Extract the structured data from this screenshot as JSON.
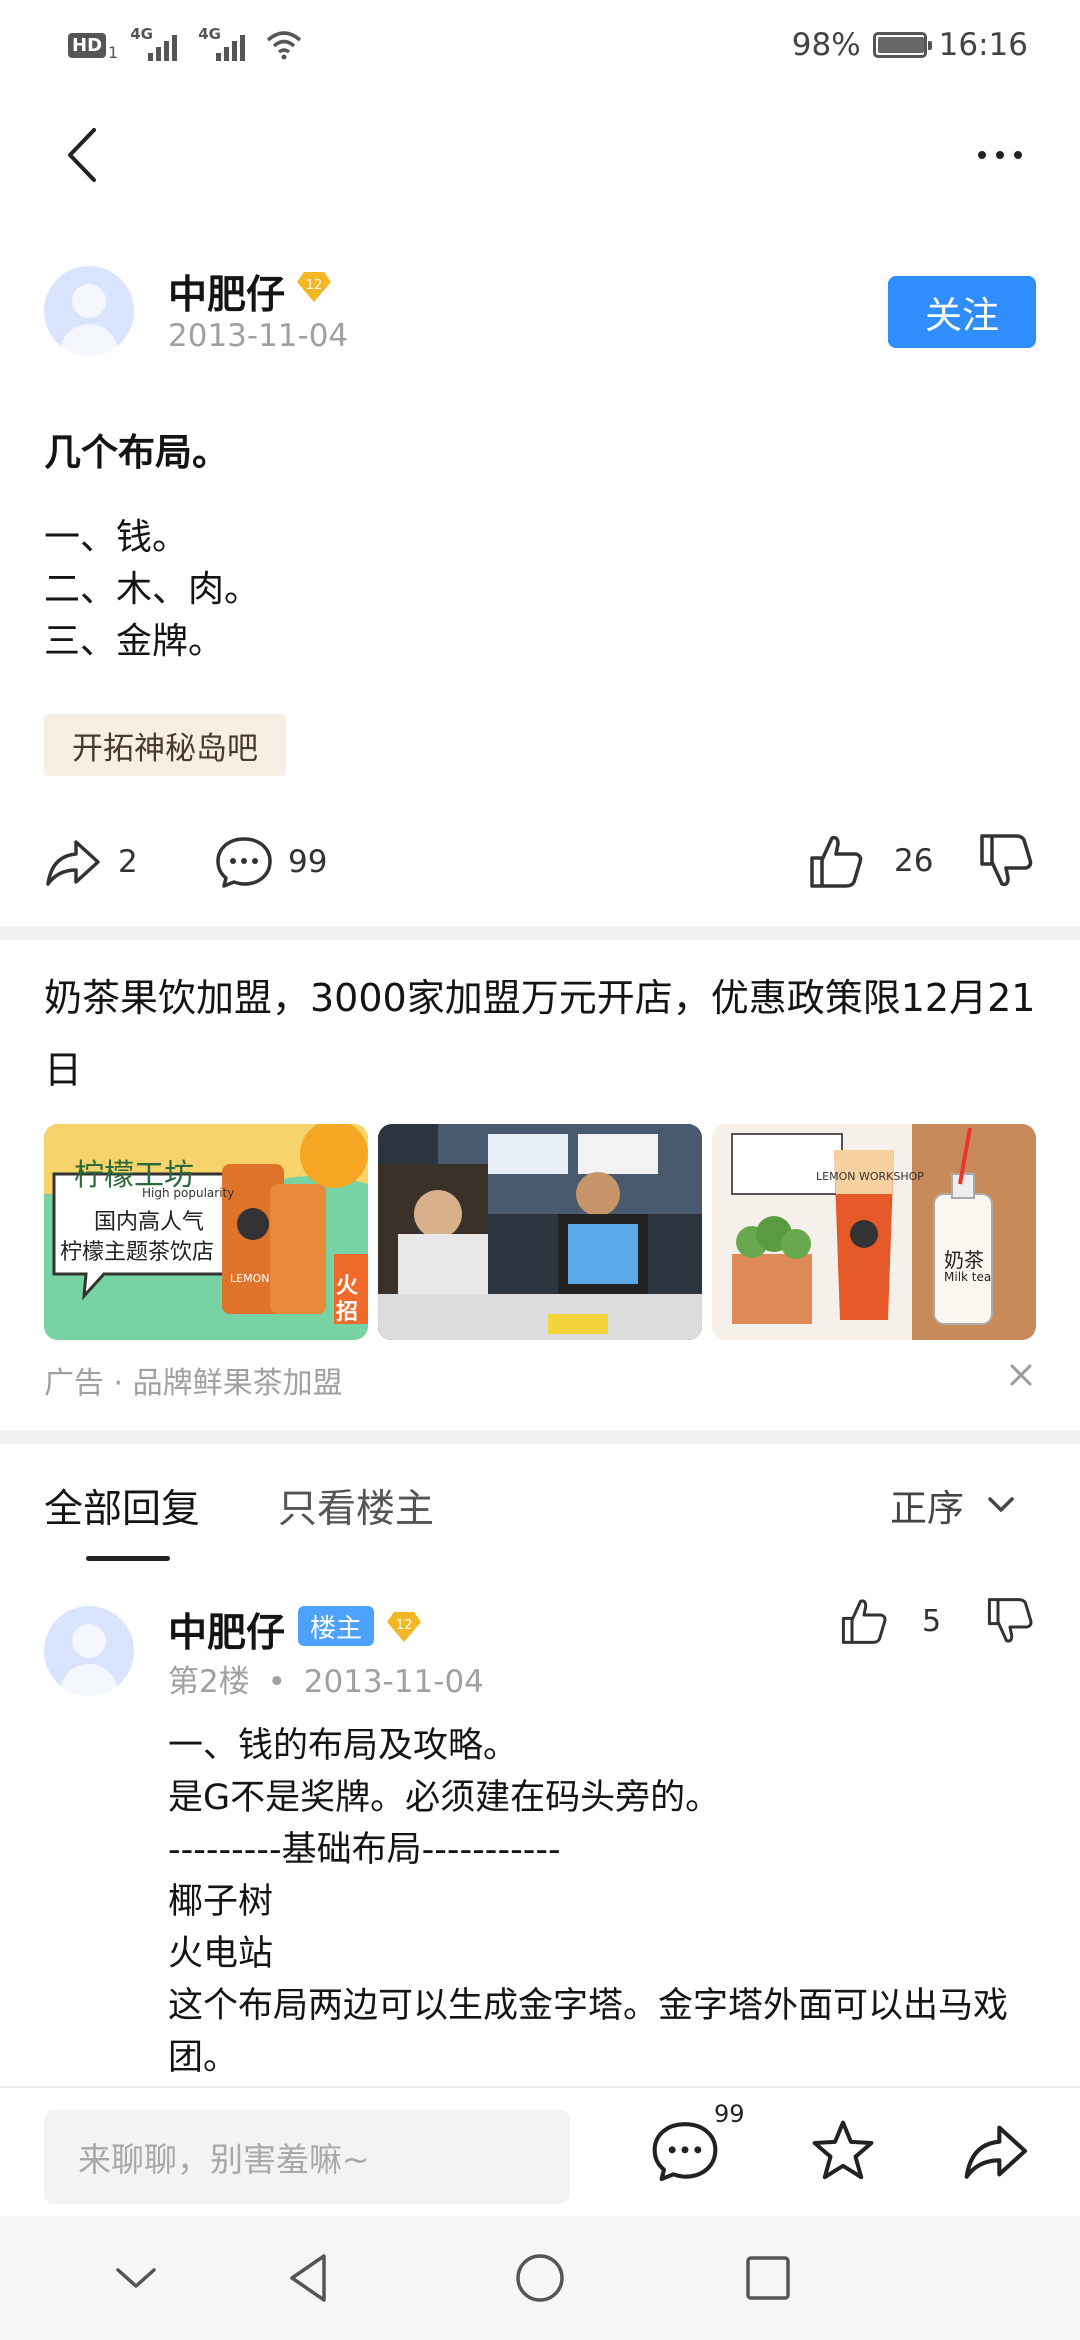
{
  "status_bar": {
    "hd": "HD",
    "hd_sub": "1",
    "net1": "4G",
    "net2": "4G",
    "battery": "98%",
    "time": "16:16"
  },
  "post": {
    "author": "中肥仔",
    "level": "12",
    "date": "2013-11-04",
    "follow_label": "关注",
    "title": "几个布局。",
    "lines": [
      "一、钱。",
      "二、木、肉。",
      "三、金牌。"
    ],
    "forum_tag": "开拓神秘岛吧",
    "share_count": "2",
    "comment_count": "99",
    "like_count": "26"
  },
  "ad": {
    "title": "奶茶果饮加盟，3000家加盟万元开店，优惠政策限12月21日",
    "label": "广告 · 品牌鲜果茶加盟",
    "image1": {
      "brand": "柠檬工坊",
      "sub": "High popularity",
      "line1": "国内高人气",
      "line2": "柠檬主题茶饮店",
      "side": "火招",
      "cup": "LEMON"
    },
    "image3": {
      "brand": "LEMON WORKSHOP",
      "tag_cn": "奶茶",
      "tag_en": "Milk tea"
    }
  },
  "replies": {
    "tab_all": "全部回复",
    "tab_op": "只看楼主",
    "sort": "正序",
    "items": [
      {
        "author": "中肥仔",
        "op_badge": "楼主",
        "level": "12",
        "floor": "第2楼",
        "separator": "•",
        "date": "2013-11-04",
        "likes": "5",
        "lines": [
          "一、钱的布局及攻略。",
          "是G不是奖牌。必须建在码头旁的。",
          "---------基础布局-----------",
          "椰子树",
          "火电站",
          "这个布局两边可以生成金字塔。金字塔外面可以出马戏团。"
        ]
      }
    ]
  },
  "bottom_bar": {
    "placeholder": "来聊聊，别害羞嘛~",
    "comment_count": "99"
  },
  "icons": {
    "back": "back-icon",
    "more": "more-icon",
    "share": "share-icon",
    "comment": "comment-icon",
    "like": "thumbs-up-icon",
    "dislike": "thumbs-down-icon",
    "star": "star-icon",
    "close": "close-icon"
  },
  "colors": {
    "accent": "#2f8efb",
    "op_badge": "#4da1ff",
    "level_badge": "#f5b623",
    "tag_bg": "#f7efe4",
    "muted_text": "#a0a0a0"
  }
}
